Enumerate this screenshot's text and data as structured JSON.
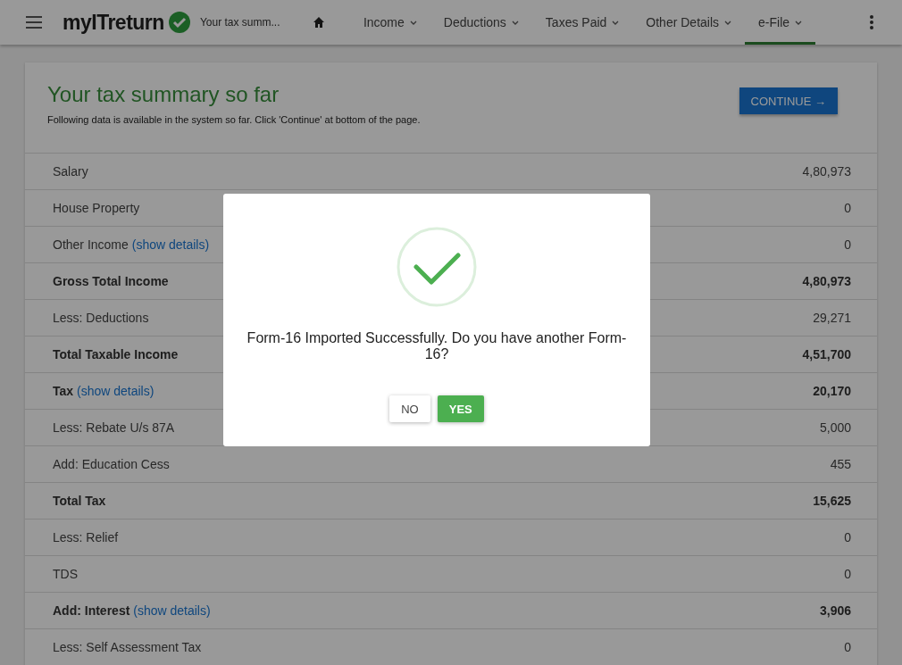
{
  "header": {
    "logo": "myITreturn",
    "page_title": "Your tax summ...",
    "nav": [
      {
        "label": "Income",
        "selected": false
      },
      {
        "label": "Deductions",
        "selected": false
      },
      {
        "label": "Taxes Paid",
        "selected": false
      },
      {
        "label": "Other Details",
        "selected": false
      },
      {
        "label": "e-File",
        "selected": true
      }
    ]
  },
  "summary": {
    "title": "Your tax summary so far",
    "subtitle": "Following data is available in the system so far. Click 'Continue' at bottom of the page.",
    "continue_button": "CONTINUE →",
    "rows": [
      {
        "label": "Salary",
        "value": "4,80,973",
        "bold": false
      },
      {
        "label": "House Property",
        "value": "0",
        "bold": false
      },
      {
        "label": "Other Income",
        "link": "(show details)",
        "value": "0",
        "bold": false
      },
      {
        "label": "Gross Total Income",
        "value": "4,80,973",
        "bold": true
      },
      {
        "label": "Less: Deductions",
        "value": "29,271",
        "bold": false
      },
      {
        "label": "Total Taxable Income",
        "value": "4,51,700",
        "bold": true
      },
      {
        "label": "Tax",
        "link": "(show details)",
        "value": "20,170",
        "bold": true
      },
      {
        "label": "Less: Rebate U/s 87A",
        "value": "5,000",
        "bold": false
      },
      {
        "label": "Add: Education Cess",
        "value": "455",
        "bold": false
      },
      {
        "label": "Total Tax",
        "value": "15,625",
        "bold": true
      },
      {
        "label": "Less: Relief",
        "value": "0",
        "bold": false
      },
      {
        "label": "TDS",
        "value": "0",
        "bold": false
      },
      {
        "label": "Add: Interest",
        "link": "(show details)",
        "value": "3,906",
        "bold": true
      },
      {
        "label": "Less: Self Assessment Tax",
        "value": "0",
        "bold": false
      }
    ]
  },
  "dialog": {
    "message": "Form-16 Imported Successfully. Do you have another Form-16?",
    "buttons": [
      {
        "label": "NO",
        "kind": "flat"
      },
      {
        "label": "YES",
        "kind": "primary"
      }
    ]
  }
}
